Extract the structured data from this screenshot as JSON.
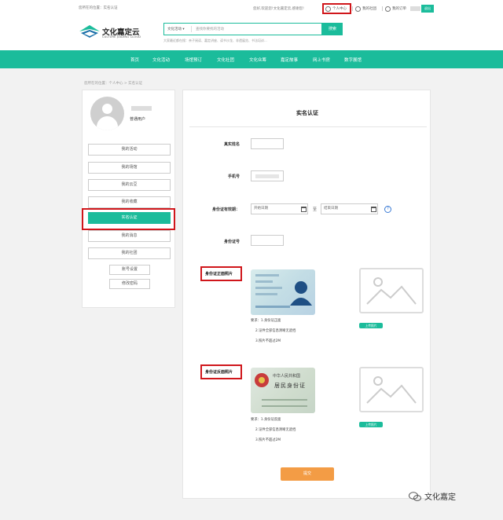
{
  "topbar": {
    "location": "您所在的位置：实名认证",
    "welcome": "您好,欢迎您!文化嘉定云,感谢您!",
    "personal_center": "个人中心",
    "my_community": "我的社团",
    "my_orders": "我的订单",
    "logout": "退出"
  },
  "header": {
    "brand_cn": "文化嘉定云",
    "brand_en": "CULTURE JIADING CLOUD",
    "search_category": "文化活动 ▾",
    "search_placeholder": "查找你要找的活动",
    "search_button": "搜索",
    "hot_searches": "大家最近都在搜：亲子阅读、嘉定讲座、读书沙龙、非遗展览、书法培训..."
  },
  "nav": [
    "首页",
    "文化活动",
    "场馆预订",
    "文化社团",
    "文化众筹",
    "嘉定故事",
    "网上书房",
    "数字展馆"
  ],
  "breadcrumb": "您所在的位置：个人中心 > 实名认证",
  "sidebar": {
    "user_role": "普通用户",
    "menu": [
      "我的活动",
      "我的场馆",
      "我的云豆",
      "我的收藏",
      "实名认证",
      "我的消息",
      "我的社团"
    ],
    "active_item": "实名认证",
    "settings": [
      "账号设置",
      "修改密码"
    ]
  },
  "main": {
    "title": "实名认证",
    "fields": {
      "real_name_label": "真实姓名",
      "phone_label": "手机号",
      "validity_label": "身份证有效期：",
      "start_date": "开始日期",
      "to": "至",
      "end_date": "结束日期",
      "id_number_label": "身份证号"
    },
    "front": {
      "label": "身份证正面照片",
      "upload": "上传照片",
      "req1": "要求：1.身份证正面",
      "req2": "2.证件全部信息清晰无遮挡",
      "req3": "3.照片不超过2M"
    },
    "back": {
      "label": "身份证反面照片",
      "card_title1": "中华人民共和国",
      "card_title2": "居民身份证",
      "upload": "上传照片",
      "req1": "要求：1.身份证反面",
      "req2": "2.证件全部信息清晰无遮挡",
      "req3": "3.照片不超过2M"
    },
    "submit": "提交"
  },
  "watermark": "文化嘉定",
  "colors": {
    "accent": "#1bbc9b",
    "submit": "#f39c45",
    "highlight": "#d0161b"
  }
}
